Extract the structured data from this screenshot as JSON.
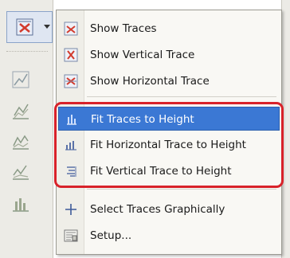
{
  "menu": {
    "items": [
      {
        "label": "Show Traces",
        "icon": "show-traces-icon"
      },
      {
        "label": "Show Vertical Trace",
        "icon": "vertical-trace-icon"
      },
      {
        "label": "Show Horizontal Trace",
        "icon": "horizontal-trace-icon"
      },
      {
        "label": "Fit Traces to Height",
        "icon": "fit-traces-icon",
        "highlighted": true
      },
      {
        "label": "Fit Horizontal Trace to Height",
        "icon": "fit-horizontal-icon"
      },
      {
        "label": "Fit Vertical Trace to Height",
        "icon": "fit-vertical-icon"
      },
      {
        "label": "Select Traces Graphically",
        "icon": "crosshair-icon"
      },
      {
        "label": "Setup...",
        "icon": "setup-icon"
      }
    ]
  },
  "colors": {
    "highlight": "#3b78d4",
    "annotation_box": "#d8222a",
    "menu_background": "#f9f8f4",
    "toolbar_background": "#ecebe6"
  }
}
